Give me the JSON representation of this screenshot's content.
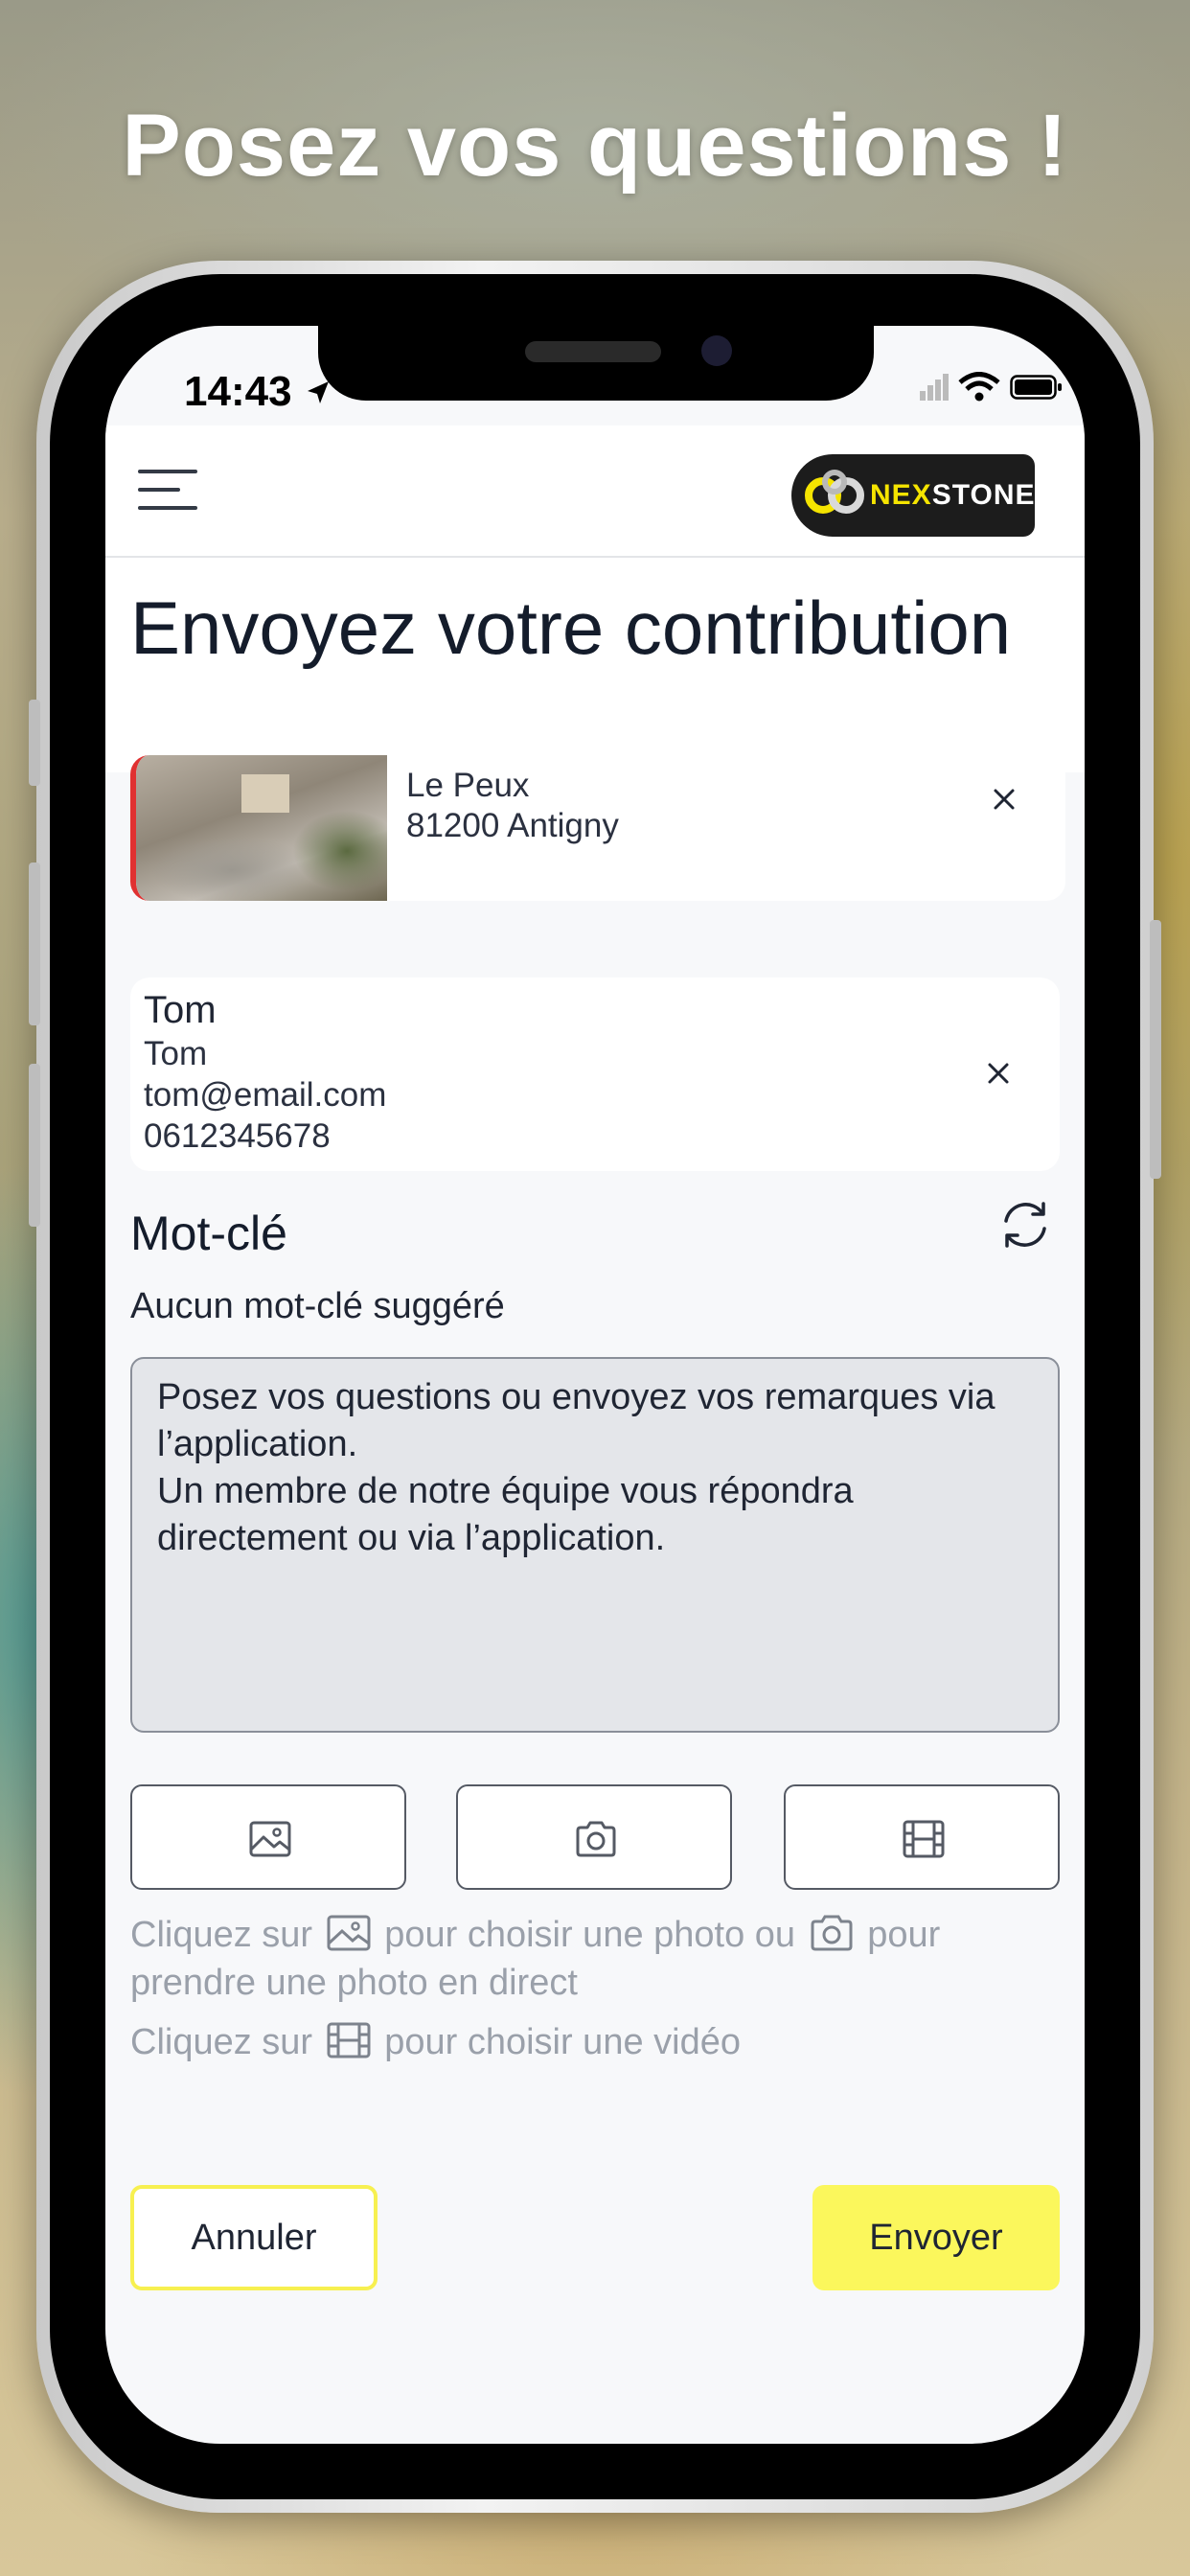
{
  "promo": {
    "headline": "Posez vos questions !"
  },
  "status_bar": {
    "time": "14:43"
  },
  "header": {
    "logo_text_1": "NEX",
    "logo_text_2": "STONE"
  },
  "page": {
    "title": "Envoyez votre contribution"
  },
  "site_card": {
    "line1": "Le Peux",
    "line2": "81200 Antigny"
  },
  "contact_card": {
    "name": "Tom",
    "firstname": "Tom",
    "email": "tom@email.com",
    "phone": "0612345678"
  },
  "keyword": {
    "title": "Mot-clé",
    "none_text": "Aucun mot-clé suggéré"
  },
  "message": {
    "placeholder": "Posez vos questions ou envoyez vos remarques via l’application.\nUn membre de notre équipe vous répondra directement ou via l’application."
  },
  "hints": {
    "line1_a": "Cliquez sur",
    "line1_b": "pour choisir une photo ou",
    "line1_c": "pour",
    "line2": "prendre une photo en direct",
    "line3_a": "Cliquez sur",
    "line3_b": "pour choisir une vidéo"
  },
  "actions": {
    "cancel_label": "Annuler",
    "send_label": "Envoyer"
  },
  "colors": {
    "accent_yellow": "#fbf75c",
    "site_marker": "#e03131",
    "title_text": "#141c2b"
  },
  "icons": [
    "menu-icon",
    "close-icon",
    "refresh-icon",
    "image-icon",
    "camera-icon",
    "video-icon",
    "wifi-icon",
    "battery-icon",
    "signal-icon",
    "location-arrow-icon"
  ]
}
